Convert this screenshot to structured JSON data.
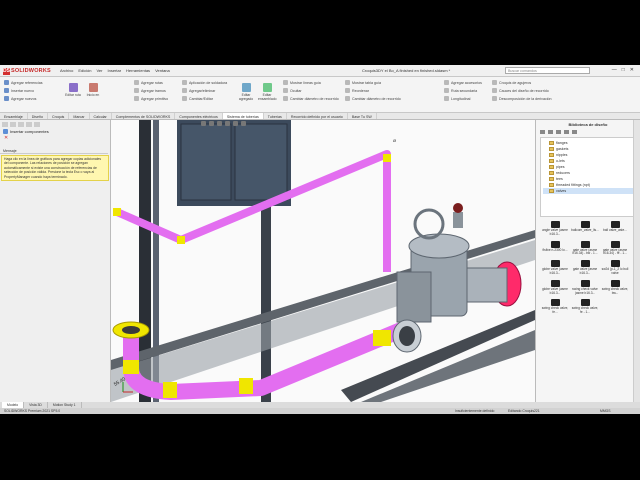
{
  "app": {
    "logo": "SOLIDWORKS",
    "logo_mark": "DS"
  },
  "menu": [
    "Archivo",
    "Edición",
    "Ver",
    "Insertar",
    "Herramientas",
    "Ventana"
  ],
  "document_title": "Croquis3DY el Bo_A finished en finished.sldasm *",
  "search_placeholder": "Buscar comandos",
  "window_controls": [
    "—",
    "□",
    "✕"
  ],
  "commands": {
    "col1": [
      "Agregar referencias",
      "Insertar nuevo",
      "Agregar nuevos"
    ],
    "col2": [
      "Agregar rutas",
      "Agregar tramos",
      "Agregar primitivo"
    ],
    "col3": [
      "Aplicación de soldadura",
      "Agregar/eliminar",
      "Cambiar/Editar"
    ],
    "col4": [
      "Mostrar líneas guía",
      "Ocultar",
      "Cambiar diámetro de recorrido"
    ],
    "col5": [
      "Mostrar tabla guía",
      "Reordenar",
      "Cambiar diámetro de recorrido"
    ],
    "col6": [
      "Agregar accesorios",
      "Ruta secundaria",
      "Longitudinal"
    ],
    "col7": [
      "Croquis de agujeros",
      "Cauces del diseño de recorrido",
      "Descomposición de la derivación"
    ],
    "big": [
      "Editar ruta",
      "Inicio en",
      "Editar agregado",
      "Editar ensamblado"
    ]
  },
  "tabs": [
    "Ensamblaje",
    "Diseño",
    "Croquis",
    "Marcar",
    "Calcular",
    "Complementos de SOLIDWORKS",
    "Componentes eléctricos",
    "Sistema de tuberías",
    "Tuberías",
    "Recorrido definido por el usuario",
    "Base Tu SW"
  ],
  "active_tab": "Sistema de tuberías",
  "property_manager": {
    "title": "Insertar componentes",
    "section": "Mensaje",
    "message": "Haga clic en la línea de gráficos para agregar copias adicionales del componente. Las relaciones de posición se agregan automáticamente si existe una construcción de referencias de selección de posición válida. Presione la tecla Esc o vaya al PropertyManager cuando haya terminado."
  },
  "task_pane": {
    "title": "Biblioteca de diseño",
    "tree": [
      "flanges",
      "gaskets",
      "nipples",
      "o-lets",
      "pipes",
      "reducers",
      "tees",
      "threaded fittings (npt)",
      "valves"
    ],
    "selected": "valves",
    "items": [
      {
        "label": "angle valve (asme b16.3..."
      },
      {
        "label": "ballcom_valve_lis..."
      },
      {
        "label": "ball valve_aste..."
      },
      {
        "label": "flsfixe n-2300 lo..."
      },
      {
        "label": "gate valve (asme b16.34) - bw - 1..."
      },
      {
        "label": "gate valve (asme b16.34) - fe - 1..."
      },
      {
        "label": "globe valve (asme b16.3..."
      },
      {
        "label": "gate valve (asme b16.3..."
      },
      {
        "label": "sw2d (p-1_2 lo bull valve"
      },
      {
        "label": "globe valve (asme b16.3..."
      },
      {
        "label": "swing check valve (asme b16.3..."
      },
      {
        "label": "swing check valve, bw..."
      },
      {
        "label": "swing check valve, fe..."
      },
      {
        "label": "swing check valve, fe - 1..."
      }
    ]
  },
  "viewport": {
    "dimension_label": "55.40"
  },
  "bottom_tabs": [
    "Modelo",
    "Vista 3D",
    "Motion Study 1"
  ],
  "active_bottom_tab": "Modelo",
  "status": {
    "left": "SOLIDWORKS Premium 2021 SP5.0",
    "mid": "Insuficientemente definido",
    "right1": "Editando Croquis221",
    "right2": "MMGS"
  },
  "colors": {
    "pipe": "#e36ef0",
    "weld": "#f0e600",
    "flange_face": "#ff2a6a",
    "accent": "#c62828",
    "message_bg": "#fff7b0"
  }
}
